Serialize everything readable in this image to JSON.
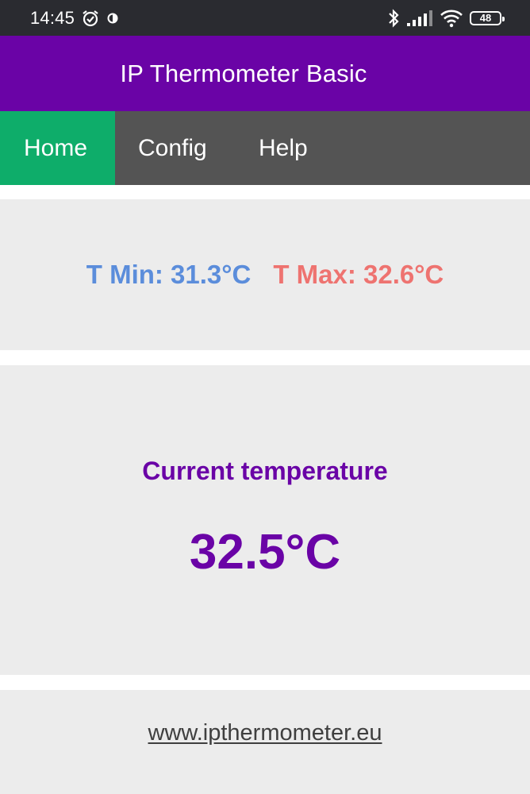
{
  "status_bar": {
    "time": "14:45",
    "battery": "48",
    "icons": [
      "alarm-icon",
      "data-saver-icon",
      "bluetooth-icon",
      "signal-icon",
      "wifi-icon",
      "battery-icon"
    ]
  },
  "header": {
    "title": "IP Thermometer Basic"
  },
  "nav": {
    "tabs": [
      {
        "label": "Home",
        "active": true
      },
      {
        "label": "Config",
        "active": false
      },
      {
        "label": "Help",
        "active": false
      }
    ]
  },
  "minmax": {
    "min_text": "T Min: 31.3°C",
    "max_text": "T Max: 32.6°C"
  },
  "current": {
    "label": "Current temperature",
    "value": "32.5°C"
  },
  "footer": {
    "link": "www.ipthermometer.eu"
  },
  "colors": {
    "header": "#6a03a6",
    "nav": "#545454",
    "active_tab": "#0ead6a",
    "min": "#5b8ddb",
    "max": "#ee7370",
    "panel": "#ececec"
  }
}
